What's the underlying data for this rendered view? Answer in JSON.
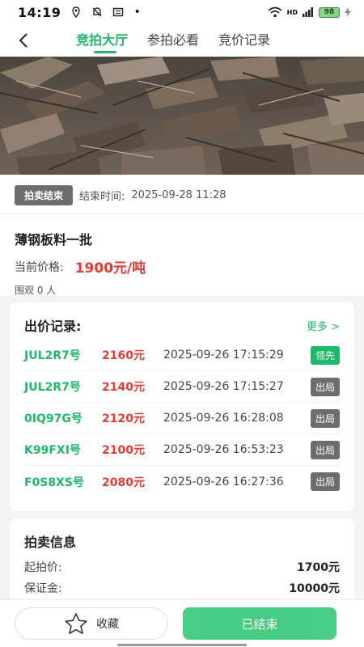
{
  "status_bar": {
    "time": "14:19",
    "battery": "98",
    "network": "HD"
  },
  "tabs": [
    {
      "label": "竞拍大厅",
      "active": true
    },
    {
      "label": "参拍必看",
      "active": false
    },
    {
      "label": "竞价记录",
      "active": false
    }
  ],
  "auction": {
    "status_badge": "拍卖结束",
    "end_time_label": "结束时间:",
    "end_time": "2025-09-28 11:28",
    "title": "薄钢板料一批",
    "price_label": "当前价格:",
    "price": "1900元/吨",
    "viewers": "围观 0 人"
  },
  "bids": {
    "title": "出价记录:",
    "more": "更多 >",
    "rows": [
      {
        "id": "JUL2R7号",
        "amount": "2160元",
        "time": "2025-09-26 17:15:29",
        "badge": "领先",
        "lead": true
      },
      {
        "id": "JUL2R7号",
        "amount": "2140元",
        "time": "2025-09-26 17:15:27",
        "badge": "出局",
        "lead": false
      },
      {
        "id": "0IQ97G号",
        "amount": "2120元",
        "time": "2025-09-26 16:28:08",
        "badge": "出局",
        "lead": false
      },
      {
        "id": "K99FXI号",
        "amount": "2100元",
        "time": "2025-09-26 16:53:23",
        "badge": "出局",
        "lead": false
      },
      {
        "id": "F0S8XS号",
        "amount": "2080元",
        "time": "2025-09-26 16:27:36",
        "badge": "出局",
        "lead": false
      }
    ]
  },
  "info": {
    "title": "拍卖信息",
    "rows": [
      {
        "label": "起拍价:",
        "value": "1700元"
      },
      {
        "label": "保证金:",
        "value": "10000元"
      }
    ]
  },
  "bottom": {
    "favorite_label": "收藏",
    "ended_label": "已结束"
  },
  "colors": {
    "accent": "#1fb86a",
    "price": "#e53935",
    "badge_gray": "#6d6d6d"
  }
}
